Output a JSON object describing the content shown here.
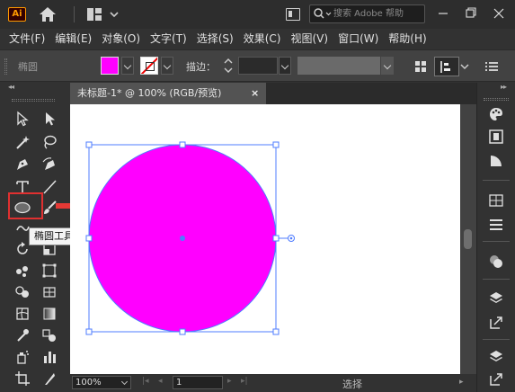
{
  "app": {
    "logo_text": "Ai"
  },
  "search": {
    "placeholder": "搜索 Adobe 帮助"
  },
  "menu": {
    "items": [
      "文件(F)",
      "编辑(E)",
      "对象(O)",
      "文字(T)",
      "选择(S)",
      "效果(C)",
      "视图(V)",
      "窗口(W)",
      "帮助(H)"
    ]
  },
  "control": {
    "selection_label": "椭圆",
    "stroke_label": "描边：",
    "fill_color": "#ff00ff"
  },
  "document": {
    "tab_title": "未标题-1* @ 100% (RGB/预览)",
    "close_glyph": "×"
  },
  "tools": {
    "tooltip": "椭圆工具 (L)",
    "active_tool": "ellipse-tool"
  },
  "canvas": {
    "shape": "circle",
    "fill": "#ff00ff",
    "selection_color": "#4f7cff"
  },
  "status": {
    "zoom": "100%",
    "artboard": "1",
    "mode": "选择"
  },
  "colors": {
    "highlight_red": "#e03030"
  }
}
